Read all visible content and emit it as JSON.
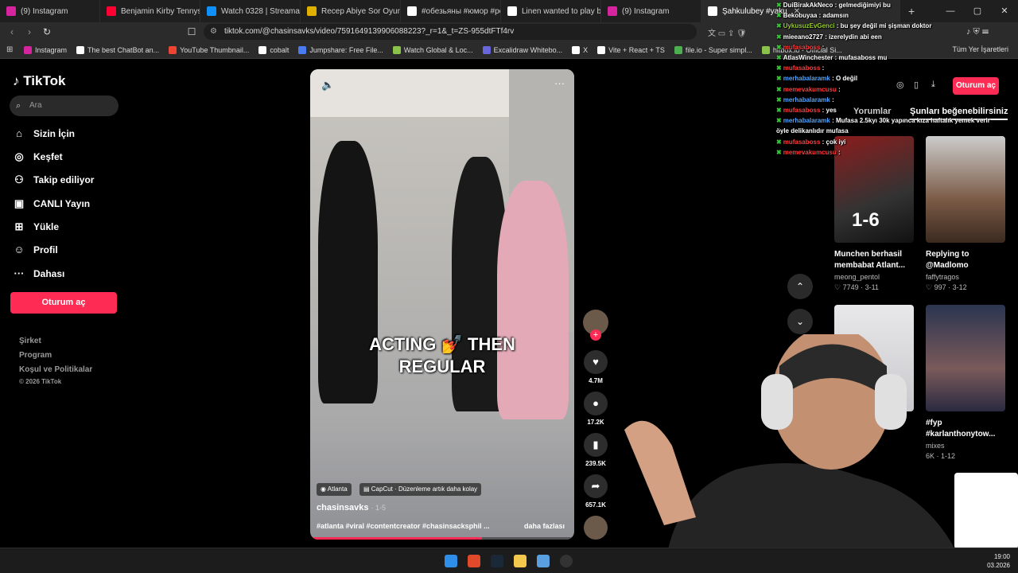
{
  "tabs": [
    {
      "title": "(9) Instagram",
      "color": "#d6249f"
    },
    {
      "title": "Benjamin Kirby Tennyson",
      "color": "#ff0033"
    },
    {
      "title": "Watch 0328 | Streamable",
      "color": "#0f90fa"
    },
    {
      "title": "Recep Abiye Sor Oyunu O",
      "color": "#e0b000"
    },
    {
      "title": "#обезьяны #юмор #рек",
      "color": "#ffffff"
    },
    {
      "title": "Linen wanted to play b",
      "color": "#ffffff"
    },
    {
      "title": "(9) Instagram",
      "color": "#d6249f"
    },
    {
      "title": "Şahkulubey #yaku",
      "color": "#ffffff",
      "active": true
    }
  ],
  "url": "tiktok.com/@chasinsavks/video/7591649139906088223?_r=1&_t=ZS-955dtFTf4rv",
  "bookmarks": [
    {
      "label": "Instagram",
      "color": "#d6249f"
    },
    {
      "label": "The best ChatBot an...",
      "color": "#ffffff"
    },
    {
      "label": "YouTube Thumbnail...",
      "color": "#e43"
    },
    {
      "label": "cobalt",
      "color": "#ffffff"
    },
    {
      "label": "Jumpshare: Free File...",
      "color": "#4a7cf0"
    },
    {
      "label": "Watch Global & Loc...",
      "color": "#8bc34a"
    },
    {
      "label": "Excalidraw Whitebo...",
      "color": "#6965db"
    },
    {
      "label": "X",
      "color": "#ffffff"
    },
    {
      "label": "Vite + React + TS",
      "color": "#ffffff"
    },
    {
      "label": "file.io - Super simpl...",
      "color": "#4caf50"
    },
    {
      "label": "hitbox.io - Official Si...",
      "color": "#8bc34a"
    }
  ],
  "bookmarks_all": "Tüm Yer İşaretleri",
  "tiktok": {
    "logo": "TikTok",
    "search_placeholder": "Ara",
    "nav": [
      "Sizin İçin",
      "Keşfet",
      "Takip ediliyor",
      "CANLI Yayın",
      "Yükle",
      "Profil",
      "Dahası"
    ],
    "login": "Oturum aç",
    "footer": [
      "Şirket",
      "Program",
      "Koşul ve Politikalar",
      "© 2026 TikTok"
    ]
  },
  "video": {
    "overlay_line1": "ACTING 💅 THEN",
    "overlay_line2": "REGULAR",
    "chip_location": "Atlanta",
    "chip_capcut": "CapCut · Düzenleme artık daha kolay",
    "author": "chasinsavks",
    "date": "· 1-5",
    "caption": "#atlanta #viral #contentcreator #chasinsacksphil ...",
    "more": "daha fazlası",
    "progress": 0.65
  },
  "actions": {
    "likes": "4.7M",
    "comments": "17.2K",
    "saves": "239.5K",
    "shares": "657.1K"
  },
  "right": {
    "login": "Oturum aç",
    "tab_comments": "Yorumlar",
    "tab_suggested": "Şunları beğenebilirsiniz",
    "cards": [
      {
        "title": "Munchen berhasil membabat Atlant...",
        "user": "meong_pentol",
        "stats": "♡ 7749 · 3-11",
        "score": "1-6"
      },
      {
        "title": "Replying to @Madlomo",
        "user": "faffytragos",
        "stats": "♡ 997 · 3-12"
      },
      {
        "title": "",
        "user": "",
        "stats": ""
      },
      {
        "title": "#fyp #karlanthonytow...",
        "user": "mixes",
        "stats": "6K · 1-12"
      }
    ]
  },
  "chat": [
    {
      "user": "DuiBirakAkNeco",
      "text": "gelmediğimiyi bu",
      "color": "#ffffff"
    },
    {
      "user": "Bekobuyaa",
      "text": "adamsın",
      "color": "#ffffff"
    },
    {
      "user": "UykusuzEvGenci",
      "text": "bu şey değil mi şişman doktor",
      "color": "#9acd32"
    },
    {
      "user": "mieeano2727",
      "text": "izerelydin abi een",
      "color": "#ffffff"
    },
    {
      "user": "mufasaboss",
      "text": "",
      "color": "#ff3b3b"
    },
    {
      "user": "AtlasWinchester",
      "text": "mufasaboss mu",
      "color": "#ffffff"
    },
    {
      "user": "mufasaboss",
      "text": "",
      "color": "#ff3b3b"
    },
    {
      "user": "merhabalaramk",
      "text": "O değil",
      "color": "#4fa3ff"
    },
    {
      "user": "memevakumcusu",
      "text": "",
      "color": "#ff3b3b"
    },
    {
      "user": "merhabalaramk",
      "text": "",
      "color": "#4fa3ff"
    },
    {
      "user": "mufasaboss",
      "text": "yes",
      "color": "#ff3b3b"
    },
    {
      "user": "merhabalaramk",
      "text": "Mufasa 2.5kyı 30k yapınca kıza haftalık yemek verir",
      "color": "#4fa3ff"
    },
    {
      "user": "",
      "text": "öyle delikanlıdır mufasa",
      "color": "#ffffff"
    },
    {
      "user": "mufasaboss",
      "text": "çok iyi",
      "color": "#ff3b3b"
    },
    {
      "user": "memevakumcusu",
      "text": "",
      "color": "#ff3b3b"
    }
  ],
  "clock": {
    "time": "19:00",
    "date": "03.2026"
  }
}
